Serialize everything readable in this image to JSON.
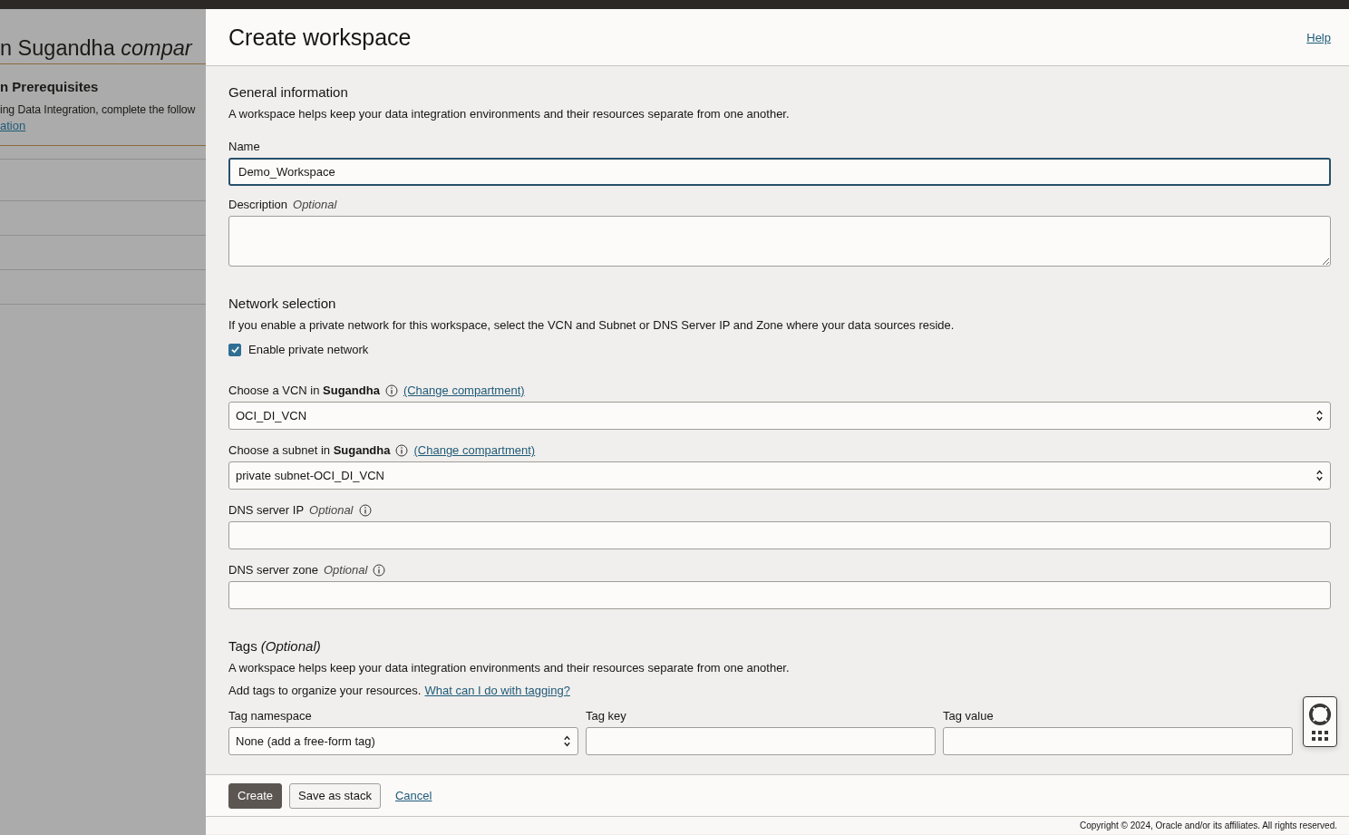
{
  "background": {
    "title": "n Sugandha *compar*",
    "heading": "n Prerequisites",
    "text": "ing Data Integration, complete the follow",
    "link": "ation"
  },
  "panel": {
    "title": "Create workspace",
    "help_link": "Help"
  },
  "general": {
    "heading": "General information",
    "description": "A workspace helps keep your data integration environments and their resources separate from one another.",
    "fields": [
      {
        "kind": "text",
        "label": "Name",
        "value": "Demo_Workspace",
        "focused": true
      },
      {
        "kind": "textarea",
        "label": "Description",
        "optional": "Optional"
      }
    ]
  },
  "network": {
    "heading": "Network selection",
    "description": "If you enable a private network for this workspace, select the VCN and Subnet or DNS Server IP and Zone where your data sources reside.",
    "checkbox": {
      "label": "Enable private network",
      "checked": true
    },
    "fields": [
      {
        "kind": "select",
        "label": "Choose a VCN in **Sugandha**",
        "info": true,
        "link": "(Change compartment)",
        "value": "OCI_DI_VCN"
      },
      {
        "kind": "select",
        "label": "Choose a subnet in **Sugandha**",
        "info": true,
        "link": "(Change compartment)",
        "value": "private subnet-OCI_DI_VCN"
      },
      {
        "kind": "text",
        "label": "DNS server IP",
        "optional": "Optional",
        "info": true
      },
      {
        "kind": "text",
        "label": "DNS server zone",
        "optional": "Optional",
        "info": true
      }
    ]
  },
  "tags": {
    "heading": "Tags *(Optional)*",
    "description": "A workspace helps keep your data integration environments and their resources separate from one another.",
    "hint": "Add tags to organize your resources.",
    "hint_link": "What can I do with tagging?",
    "columns": [
      {
        "kind": "select",
        "label": "Tag namespace",
        "value": "None (add a free-form tag)"
      },
      {
        "kind": "text",
        "label": "Tag key"
      },
      {
        "kind": "text",
        "label": "Tag value"
      }
    ]
  },
  "footer": {
    "buttons": [
      {
        "kind": "primary",
        "label": "Create"
      },
      {
        "kind": "secondary",
        "label": "Save as stack"
      },
      {
        "kind": "link",
        "label": "Cancel"
      }
    ]
  },
  "copyright": "Copyright © 2024, Oracle and/or its affiliates. All rights reserved."
}
